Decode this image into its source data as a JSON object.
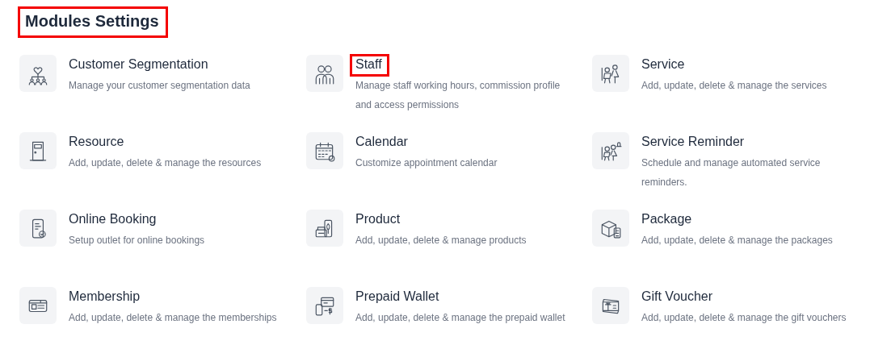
{
  "page_title": {
    "text": "Modules Settings",
    "highlighted": true
  },
  "modules": [
    {
      "kind": "segmentation",
      "title": "Customer Segmentation",
      "description": "Manage your customer segmentation data",
      "highlighted": false
    },
    {
      "kind": "staff",
      "title": "Staff",
      "description": "Manage staff working hours, commission profile and access permissions",
      "highlighted": true
    },
    {
      "kind": "service",
      "title": "Service",
      "description": "Add, update, delete & manage the services",
      "highlighted": false
    },
    {
      "kind": "resource",
      "title": "Resource",
      "description": "Add, update, delete & manage the resources",
      "highlighted": false
    },
    {
      "kind": "calendar",
      "title": "Calendar",
      "description": "Customize appointment calendar",
      "highlighted": false
    },
    {
      "kind": "reminder",
      "title": "Service Reminder",
      "description": "Schedule and manage automated service reminders.",
      "highlighted": false
    },
    {
      "kind": "booking",
      "title": "Online Booking",
      "description": "Setup outlet for online bookings",
      "highlighted": false
    },
    {
      "kind": "product",
      "title": "Product",
      "description": "Add, update, delete & manage products",
      "highlighted": false
    },
    {
      "kind": "package",
      "title": "Package",
      "description": "Add, update, delete & manage the packages",
      "highlighted": false
    },
    {
      "kind": "membership",
      "title": "Membership",
      "description": "Add, update, delete & manage the memberships",
      "highlighted": false
    },
    {
      "kind": "wallet",
      "title": "Prepaid Wallet",
      "description": "Add, update, delete & manage the prepaid wallet",
      "highlighted": false
    },
    {
      "kind": "voucher",
      "title": "Gift Voucher",
      "description": "Add, update, delete & manage the gift vouchers",
      "highlighted": false
    }
  ]
}
